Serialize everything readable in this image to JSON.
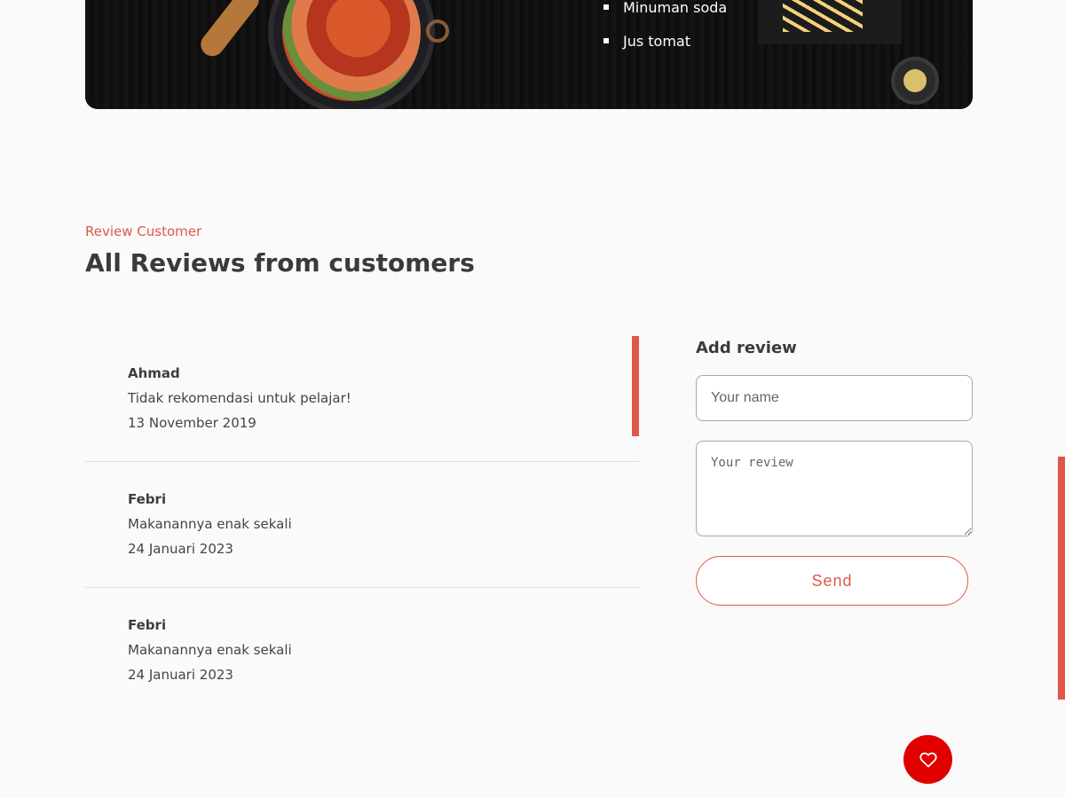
{
  "hero": {
    "menu_items": [
      "Minuman soda",
      "Jus tomat"
    ]
  },
  "reviews_section": {
    "kicker": "Review Customer",
    "title": "All Reviews from customers",
    "reviews": [
      {
        "name": "Ahmad",
        "text": "Tidak rekomendasi untuk pelajar!",
        "date": "13 November 2019"
      },
      {
        "name": "Febri",
        "text": "Makanannya enak sekali",
        "date": "24 Januari 2023"
      },
      {
        "name": "Febri",
        "text": "Makanannya enak sekali",
        "date": "24 Januari 2023"
      }
    ]
  },
  "review_form": {
    "title": "Add review",
    "name_placeholder": "Your name",
    "review_placeholder": "Your review",
    "send_label": "Send"
  },
  "floating_button": {
    "icon": "heart-icon"
  },
  "colors": {
    "accent": "#e0574a",
    "fab": "#e00000",
    "background": "#fafafa"
  }
}
